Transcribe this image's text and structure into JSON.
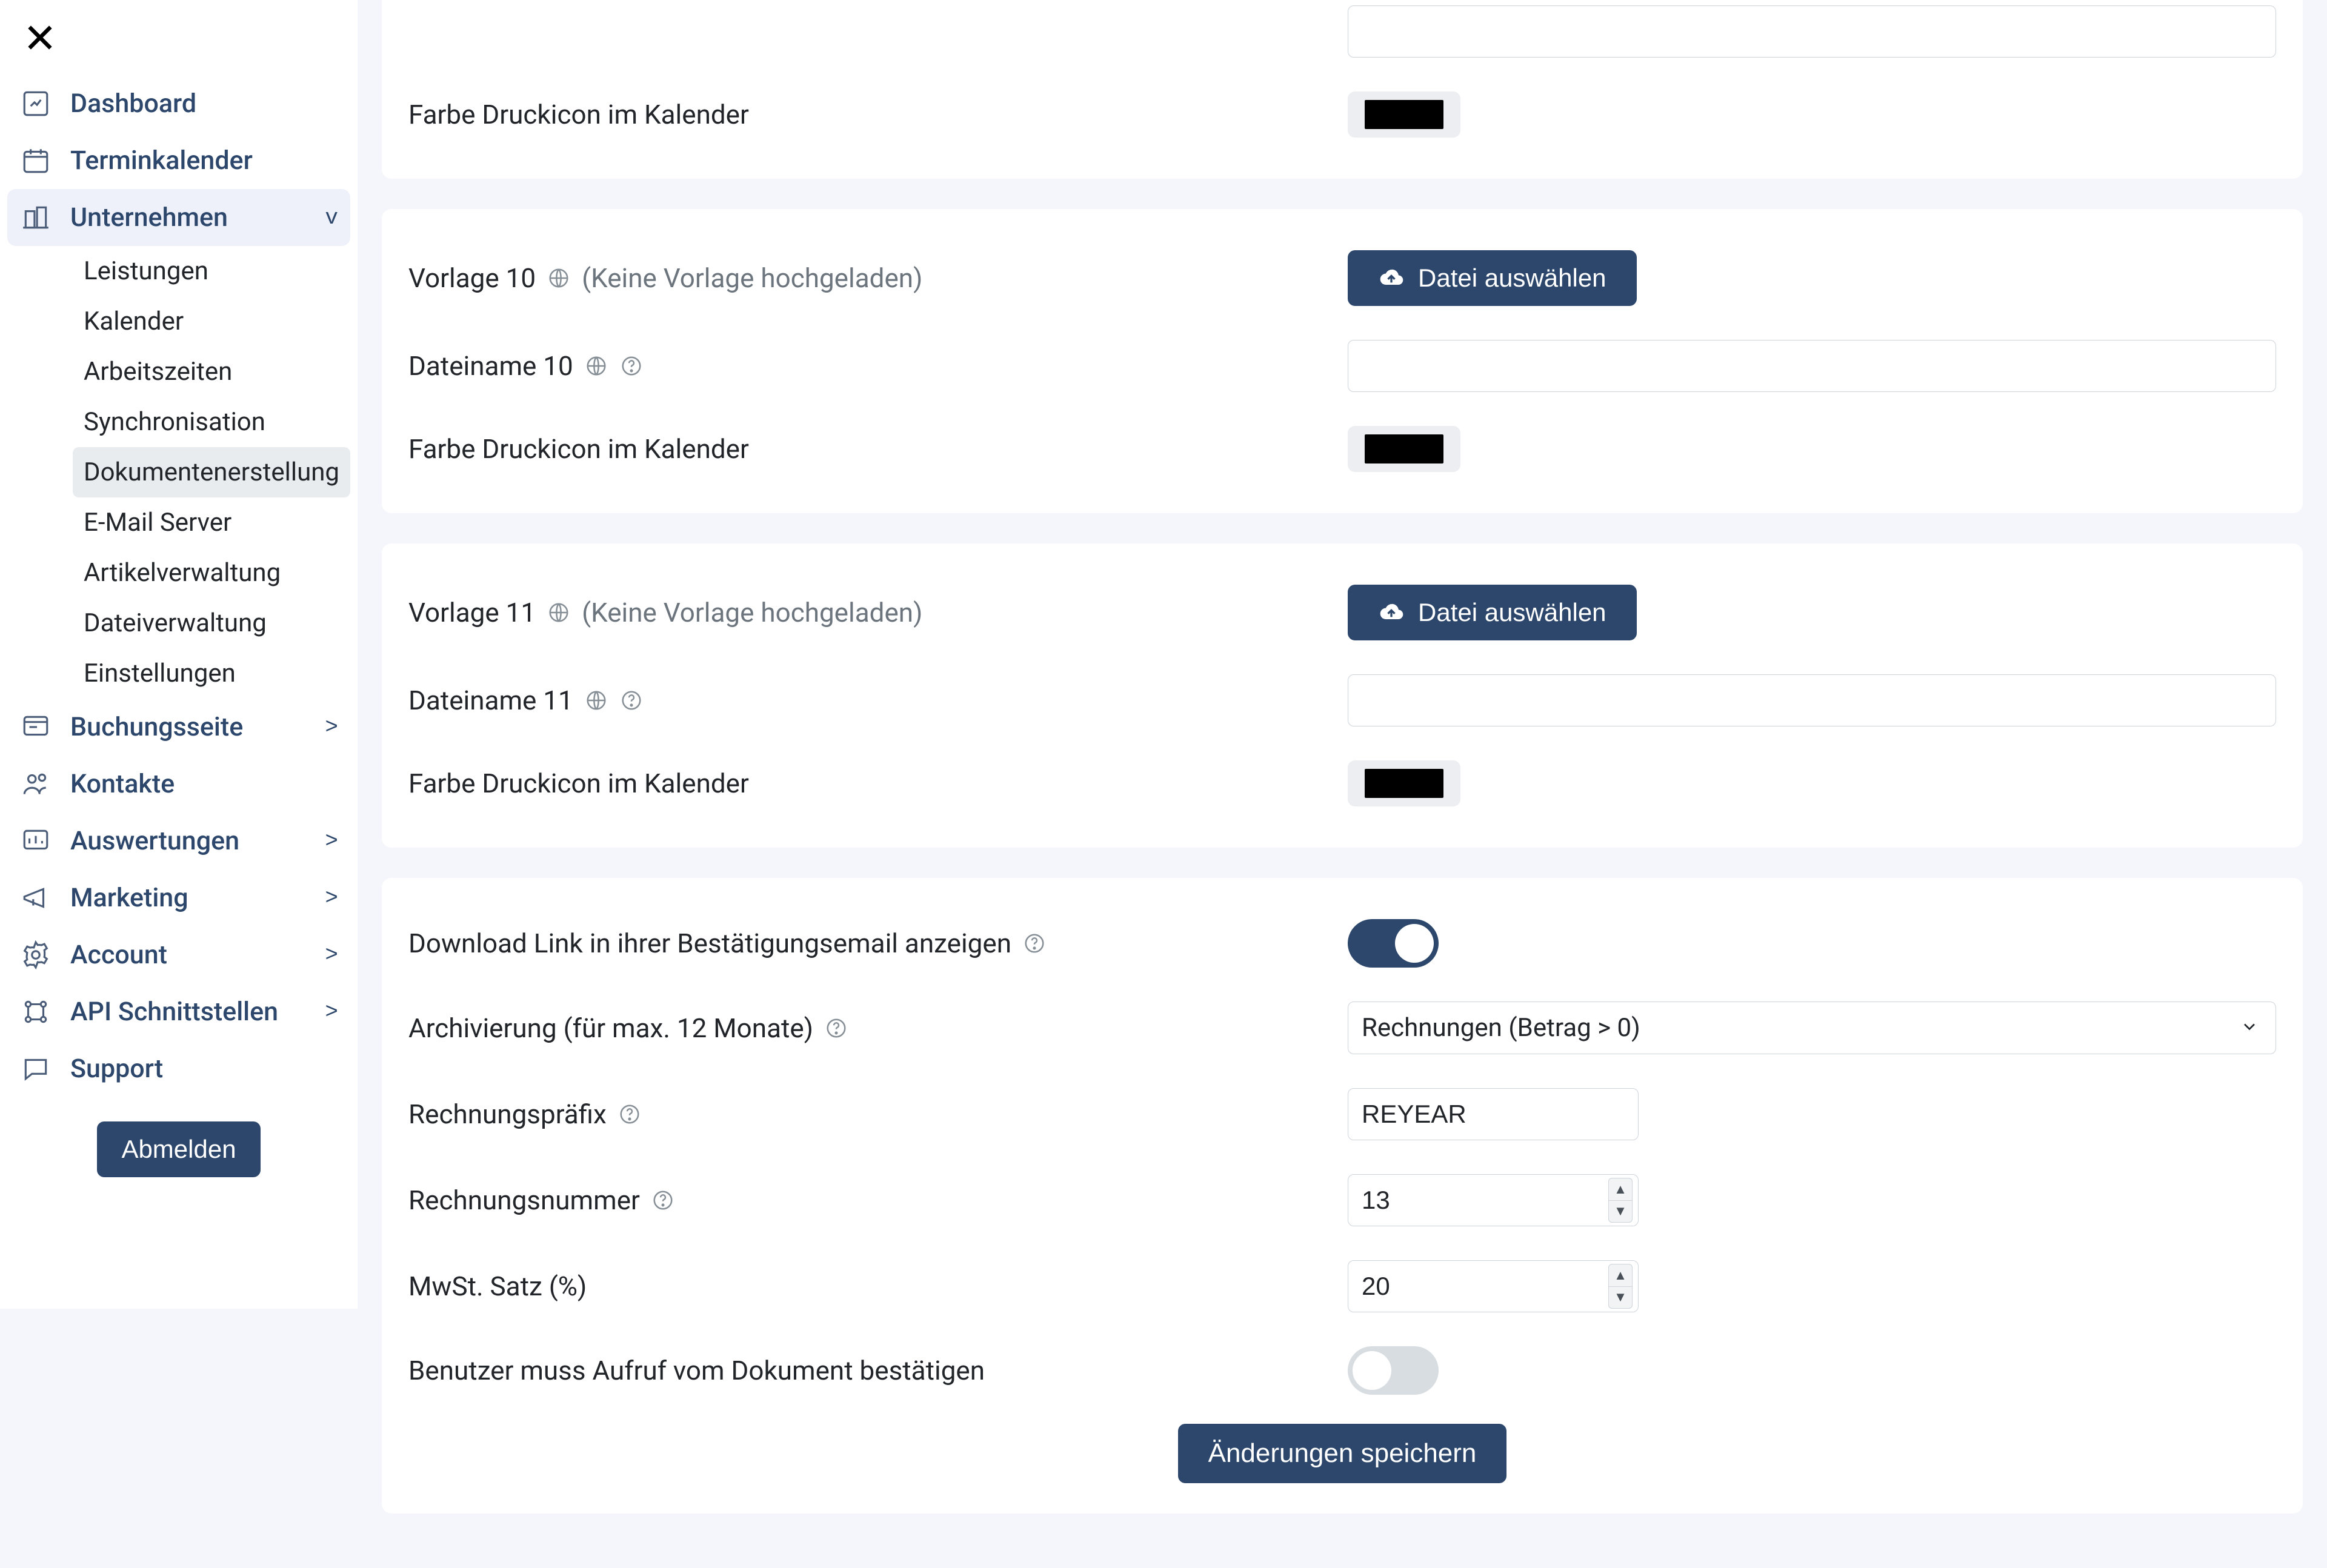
{
  "sidebar": {
    "items": [
      {
        "label": "Dashboard",
        "expandable": false
      },
      {
        "label": "Terminkalender",
        "expandable": false
      },
      {
        "label": "Unternehmen",
        "expandable": true,
        "open": true,
        "active": true
      },
      {
        "label": "Buchungsseite",
        "expandable": true
      },
      {
        "label": "Kontakte",
        "expandable": false
      },
      {
        "label": "Auswertungen",
        "expandable": true
      },
      {
        "label": "Marketing",
        "expandable": true
      },
      {
        "label": "Account",
        "expandable": true
      },
      {
        "label": "API Schnittstellen",
        "expandable": true
      },
      {
        "label": "Support",
        "expandable": false
      }
    ],
    "sub_unternehmen": [
      {
        "label": "Leistungen"
      },
      {
        "label": "Kalender"
      },
      {
        "label": "Arbeitszeiten"
      },
      {
        "label": "Synchronisation"
      },
      {
        "label": "Dokumentenerstellung",
        "selected": true
      },
      {
        "label": "E-Mail Server"
      },
      {
        "label": "Artikelverwaltung"
      },
      {
        "label": "Dateiverwaltung"
      },
      {
        "label": "Einstellungen"
      }
    ],
    "logout": "Abmelden"
  },
  "card_top": {
    "color_label": "Farbe Druckicon im Kalender",
    "color_value": "#000000"
  },
  "template10": {
    "title_prefix": "Vorlage 10",
    "title_hint": "(Keine Vorlage hochgeladen)",
    "file_btn": "Datei auswählen",
    "filename_label": "Dateiname 10",
    "filename_value": "",
    "color_label": "Farbe Druckicon im Kalender",
    "color_value": "#000000"
  },
  "template11": {
    "title_prefix": "Vorlage 11",
    "title_hint": "(Keine Vorlage hochgeladen)",
    "file_btn": "Datei auswählen",
    "filename_label": "Dateiname 11",
    "filename_value": "",
    "color_label": "Farbe Druckicon im Kalender",
    "color_value": "#000000"
  },
  "settings": {
    "download_link_label": "Download Link in ihrer Bestätigungsemail anzeigen",
    "download_link_on": true,
    "archive_label": "Archivierung (für max. 12 Monate)",
    "archive_selected": "Rechnungen (Betrag > 0)",
    "prefix_label": "Rechnungspräfix",
    "prefix_value": "REYEAR",
    "invoice_no_label": "Rechnungsnummer",
    "invoice_no_value": "13",
    "vat_label": "MwSt. Satz (%)",
    "vat_value": "20",
    "confirm_label": "Benutzer muss Aufruf vom Dokument bestätigen",
    "confirm_on": false,
    "save_btn": "Änderungen speichern"
  }
}
